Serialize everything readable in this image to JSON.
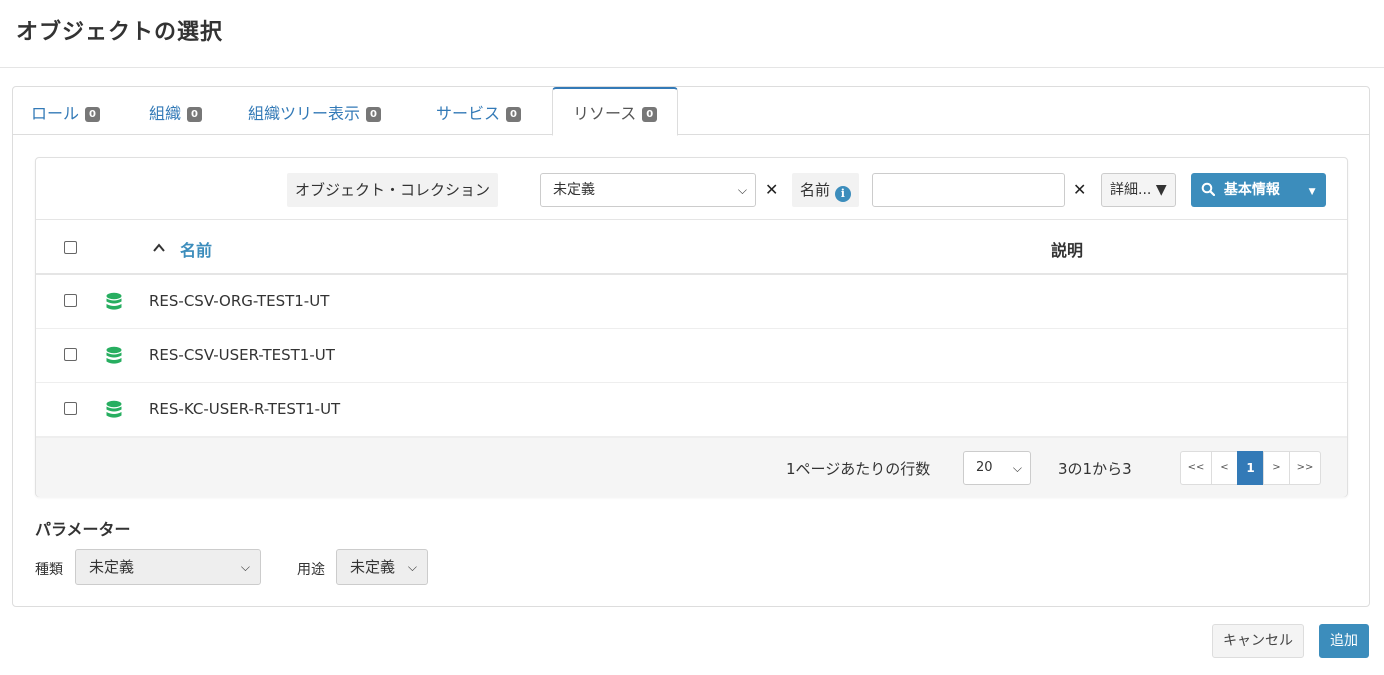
{
  "dialog": {
    "title": "オブジェクトの選択"
  },
  "tabs": [
    {
      "label": "ロール",
      "count": "0"
    },
    {
      "label": "組織",
      "count": "0"
    },
    {
      "label": "組織ツリー表示",
      "count": "0"
    },
    {
      "label": "サービス",
      "count": "0"
    },
    {
      "label": "リソース",
      "count": "0",
      "active": true
    }
  ],
  "filter": {
    "collection_label": "オブジェクト・コレクション",
    "collection_value": "未定義",
    "clear_glyph": "✕",
    "name_label": "名前",
    "info_glyph": "i",
    "name_value": "",
    "detail_label": "詳細...",
    "basic_label": "基本情報"
  },
  "table": {
    "sort_glyph": "^",
    "col_name": "名前",
    "col_description": "説明",
    "rows": [
      {
        "name": "RES-CSV-ORG-TEST1-UT",
        "description": ""
      },
      {
        "name": "RES-CSV-USER-TEST1-UT",
        "description": ""
      },
      {
        "name": "RES-KC-USER-R-TEST1-UT",
        "description": ""
      }
    ]
  },
  "paging": {
    "rows_per_page_label": "1ページあたりの行数",
    "rows_per_page": "20",
    "summary": "3の1から3",
    "first": "<<",
    "prev": "<",
    "current": "1",
    "next": ">",
    "last": ">>"
  },
  "parameters": {
    "title": "パラメーター",
    "kind_label": "種類",
    "kind_value": "未定義",
    "usage_label": "用途",
    "usage_value": "未定義"
  },
  "footer": {
    "cancel": "キャンセル",
    "add": "追加"
  },
  "colors": {
    "accent": "#3c8dbc",
    "db_icon": "#27ae60",
    "active_page": "#337ab7"
  }
}
